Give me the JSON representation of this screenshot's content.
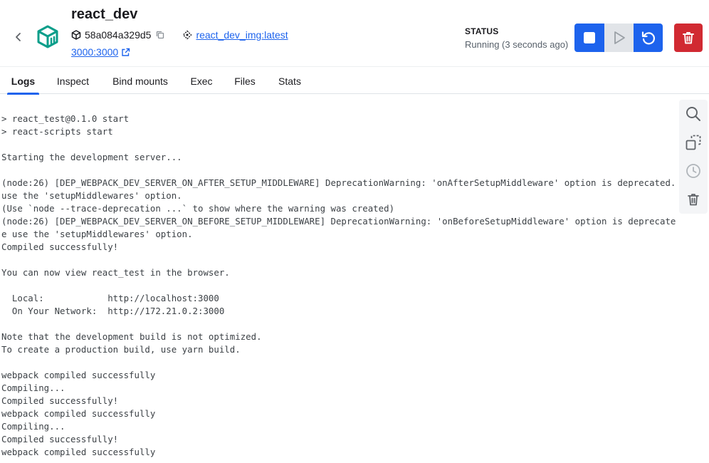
{
  "header": {
    "title": "react_dev",
    "container_id": "58a084a329d5",
    "image": "react_dev_img:latest",
    "port": "3000:3000",
    "status_label": "STATUS",
    "status_value": "Running (3 seconds ago)"
  },
  "icons": {
    "back": "chevron-left-icon",
    "container": "container-cube-icon",
    "id": "cube-icon",
    "copy": "copy-icon",
    "image": "image-layers-icon",
    "external": "external-link-icon",
    "stop": "stop-icon",
    "play": "play-icon",
    "restart": "restart-icon",
    "delete": "trash-icon",
    "search": "search-icon",
    "copy_logs": "copy-icon",
    "timestamps": "clock-icon",
    "clear": "trash-icon"
  },
  "colors": {
    "accent": "#1d63ed",
    "danger": "#d12a32",
    "container_icon": "#0b9e8a"
  },
  "tabs": [
    {
      "label": "Logs",
      "active": true
    },
    {
      "label": "Inspect",
      "active": false
    },
    {
      "label": "Bind mounts",
      "active": false
    },
    {
      "label": "Exec",
      "active": false
    },
    {
      "label": "Files",
      "active": false
    },
    {
      "label": "Stats",
      "active": false
    }
  ],
  "logs": [
    "> react_test@0.1.0 start",
    "> react-scripts start",
    "",
    "Starting the development server...",
    "",
    "(node:26) [DEP_WEBPACK_DEV_SERVER_ON_AFTER_SETUP_MIDDLEWARE] DeprecationWarning: 'onAfterSetupMiddleware' option is deprecated. Please",
    "use the 'setupMiddlewares' option.",
    "(Use `node --trace-deprecation ...` to show where the warning was created)",
    "(node:26) [DEP_WEBPACK_DEV_SERVER_ON_BEFORE_SETUP_MIDDLEWARE] DeprecationWarning: 'onBeforeSetupMiddleware' option is deprecated. Pleas",
    "e use the 'setupMiddlewares' option.",
    "Compiled successfully!",
    "",
    "You can now view react_test in the browser.",
    "",
    "  Local:            http://localhost:3000",
    "  On Your Network:  http://172.21.0.2:3000",
    "",
    "Note that the development build is not optimized.",
    "To create a production build, use yarn build.",
    "",
    "webpack compiled successfully",
    "Compiling...",
    "Compiled successfully!",
    "webpack compiled successfully",
    "Compiling...",
    "Compiled successfully!",
    "webpack compiled successfully"
  ]
}
